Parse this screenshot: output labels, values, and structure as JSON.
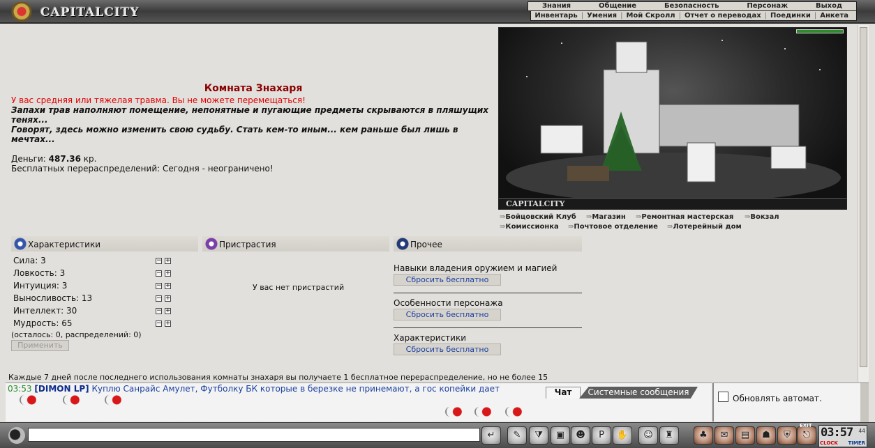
{
  "topbar": {
    "logo_text": "CAPITALCITY",
    "nav_main": [
      "Знания",
      "Общение",
      "Безопасность",
      "Персонаж",
      "Выход"
    ],
    "nav_sub": [
      "Инвентарь",
      "Умения",
      "Мой Скролл",
      "Отчет о переводах",
      "Поединки",
      "Анкета"
    ]
  },
  "room": {
    "title": "Комната Знахаря",
    "warning": "У вас средняя или тяжелая травма. Вы не можете перемещаться!",
    "desc_line1": "Запахи трав наполняют помещение, непонятные и пугающие предметы скрываются в пляшущих тенях...",
    "desc_line2": "Говорят, здесь можно изменить свою судьбу. Стать кем-то иным... кем раньше был лишь в мечтах...",
    "money_label": "Деньги:",
    "money_value": "487.36",
    "money_unit": "кр.",
    "free_realloc": "Бесплатных перераспределений: Сегодня - неограничено!"
  },
  "city": {
    "label": "CAPITALCITY",
    "links": [
      "Бойцовский Клуб",
      "Магазин",
      "Ремонтная мастерская",
      "Вокзал",
      "Комиссионка",
      "Почтовое отделение",
      "Лотерейный дом"
    ]
  },
  "panels": {
    "stats_title": "Характеристики",
    "addictions_title": "Пристрастия",
    "other_title": "Прочее",
    "stats": [
      {
        "label": "Сила:",
        "value": "3"
      },
      {
        "label": "Ловкость:",
        "value": "3"
      },
      {
        "label": "Интуиция:",
        "value": "3"
      },
      {
        "label": "Выносливость:",
        "value": "13"
      },
      {
        "label": "Интеллект:",
        "value": "30"
      },
      {
        "label": "Мудрость:",
        "value": "65"
      }
    ],
    "remains": "(осталось: 0, распределений: 0)",
    "apply": "Применить",
    "no_addictions": "У вас нет пристрастий",
    "other": [
      {
        "label": "Навыки владения оружием и магией",
        "button": "Сбросить бесплатно"
      },
      {
        "label": "Особенности персонажа",
        "button": "Сбросить бесплатно"
      },
      {
        "label": "Характеристики",
        "button": "Сбросить бесплатно"
      }
    ]
  },
  "footer_note": "Каждые 7 дней после последнего использования комнаты знахаря вы получаете 1 бесплатное перераспределение, но не более 15",
  "chat": {
    "time": "03:53",
    "nick": "[DIMON LP]",
    "message": "Куплю Санрайс Амулет, Футболку БК которые в березке не принемают, а гос копейки дает",
    "tab_chat": "Чат",
    "tab_system": "Системные сообщения",
    "autoupdate": "Обновлять автомат."
  },
  "bottombar": {
    "clock_time": "03:57",
    "clock_sec": "44",
    "clock_label": "CLOCK",
    "timer_label": "TIMER",
    "exit_label": "EXIT"
  }
}
